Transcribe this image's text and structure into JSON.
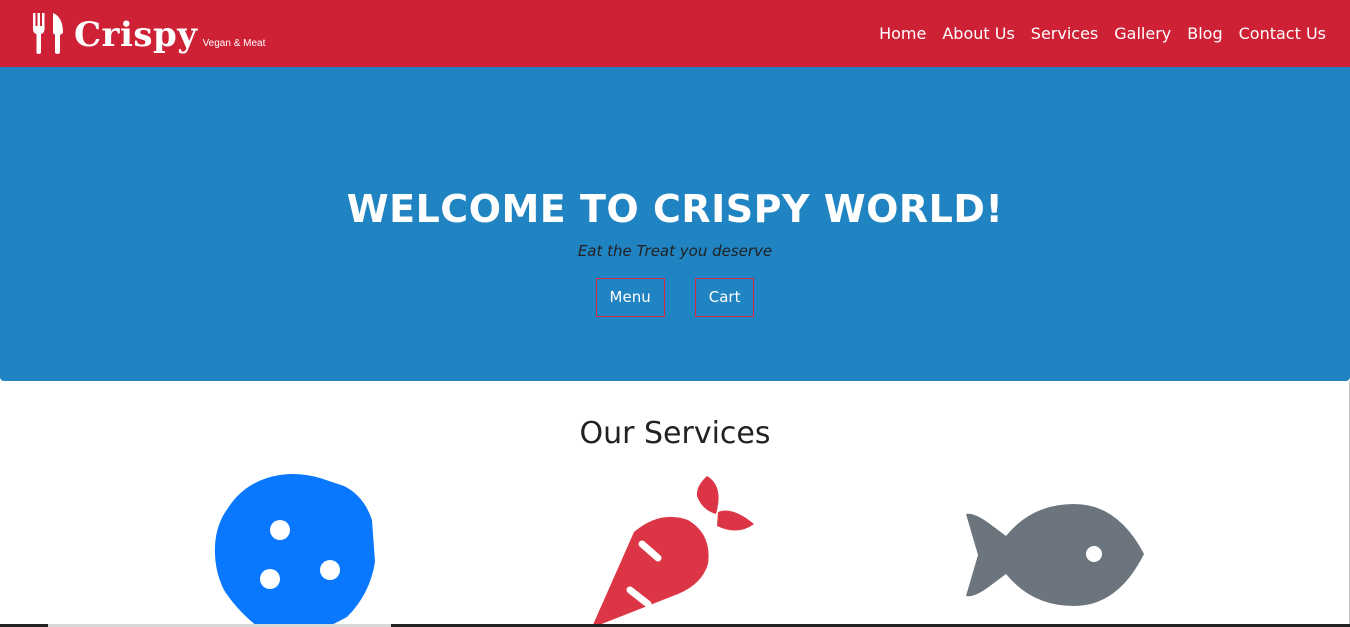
{
  "navbar": {
    "brand_name": "Crispy",
    "brand_tagline": "Vegan & Meat",
    "links": [
      "Home",
      "About Us",
      "Services",
      "Gallery",
      "Blog",
      "Contact Us"
    ],
    "color": "#cf2136"
  },
  "hero": {
    "title": "WELCOME TO CRISPY WORLD!",
    "subtitle": "Eat the Treat you deserve",
    "buttons": {
      "menu": "Menu",
      "cart": "Cart"
    },
    "color": "#2083c2"
  },
  "services": {
    "title": "Our Services",
    "icons": [
      {
        "name": "cookie-icon",
        "color": "#0a77ff"
      },
      {
        "name": "carrot-icon",
        "color": "#dc3545"
      },
      {
        "name": "fish-icon",
        "color": "#6c757d"
      }
    ]
  }
}
